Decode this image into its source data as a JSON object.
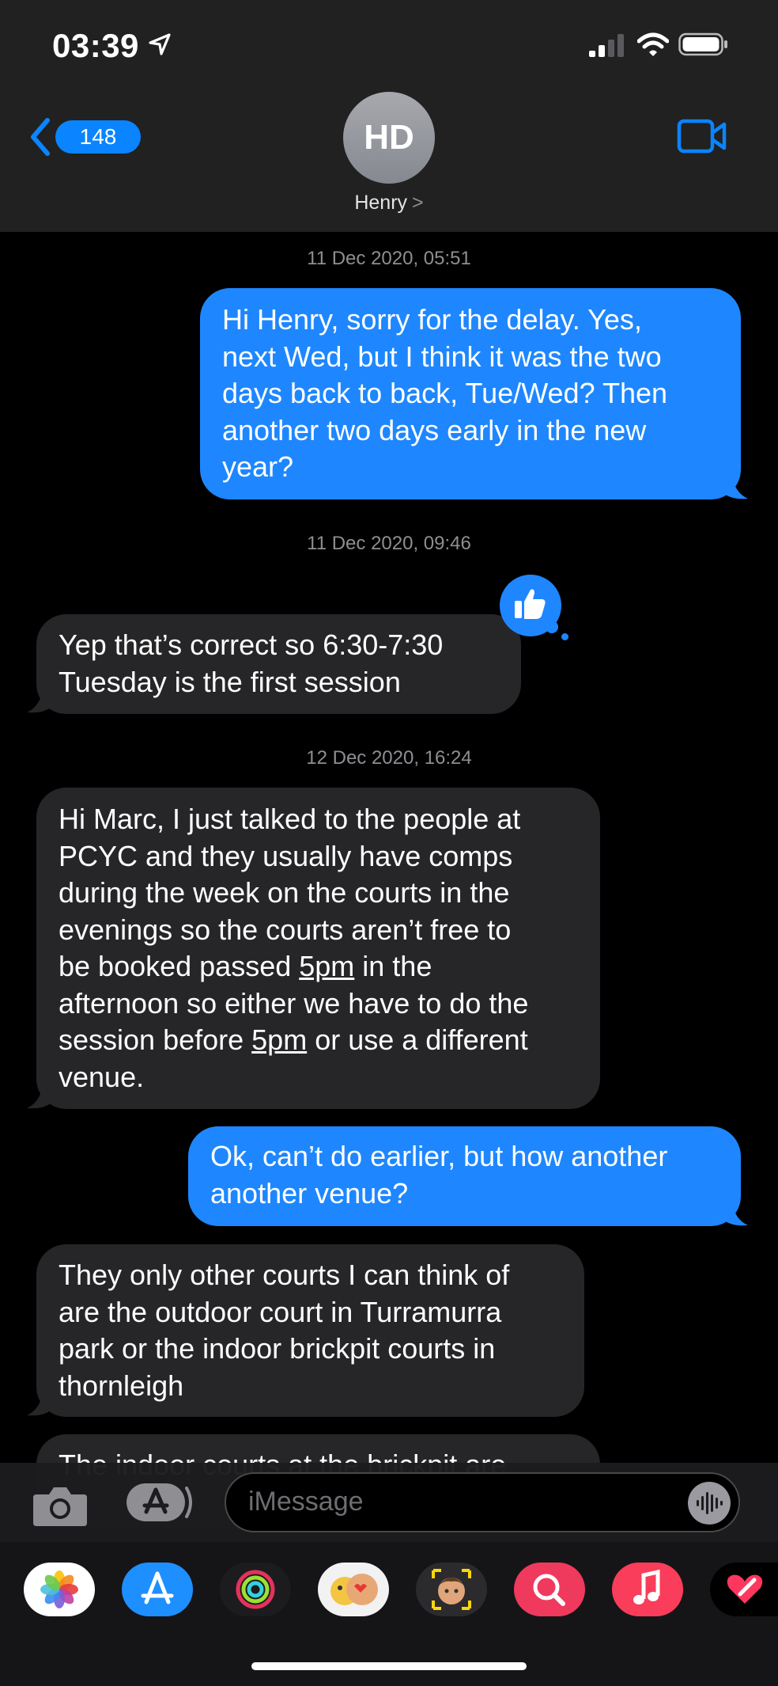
{
  "status_bar": {
    "time": "03:39"
  },
  "nav": {
    "back_count": "148",
    "avatar_initials": "HD",
    "contact_name": "Henry",
    "contact_chevron": ">"
  },
  "messages": [
    {
      "timestamp": "11 Dec 2020, 05:51"
    },
    {
      "direction": "outgoing",
      "lines": [
        "Hi Henry, sorry for the delay. Yes,",
        "next Wed, but I think it was the two",
        "days back to back, Tue/Wed?  Then",
        "another two days early in the new",
        "year?"
      ]
    },
    {
      "timestamp": "11 Dec 2020, 09:46"
    },
    {
      "direction": "incoming",
      "tapback": "thumbs-up",
      "lines": [
        "Yep that’s correct so 6:30-7:30",
        "Tuesday is the first session"
      ]
    },
    {
      "timestamp": "12 Dec 2020, 16:24"
    },
    {
      "direction": "incoming",
      "lines": [
        "Hi Marc, I just talked to the people at",
        "PCYC and they usually have comps",
        "during the week on the courts in the",
        "evenings so the courts aren’t free to",
        "be booked passed ",
        "5pm",
        " in the",
        "afternoon so either we have to do the",
        "session before ",
        "5pm",
        " or use a different",
        "venue."
      ]
    },
    {
      "direction": "outgoing",
      "lines": [
        "Ok, can’t do earlier, but how another",
        "another venue?"
      ]
    },
    {
      "direction": "incoming",
      "lines": [
        "They only other courts I can think of",
        "are the outdoor court in Turramurra",
        "park or the indoor brickpit courts in",
        "thornleigh"
      ]
    },
    {
      "direction": "incoming",
      "partial": true,
      "lines": [
        "The indoor courts at the brickpit are"
      ]
    }
  ],
  "composer": {
    "placeholder": "iMessage"
  },
  "app_drawer": [
    "photos-app",
    "app-store-app",
    "activity-app",
    "memoji-stickers-app",
    "animoji-app",
    "images-search-app",
    "music-app",
    "digital-touch-app"
  ],
  "colors": {
    "outgoing_bubble": "#1e87ff",
    "incoming_bubble": "#262628",
    "accent": "#0a84ff",
    "header_bg": "#212121"
  }
}
